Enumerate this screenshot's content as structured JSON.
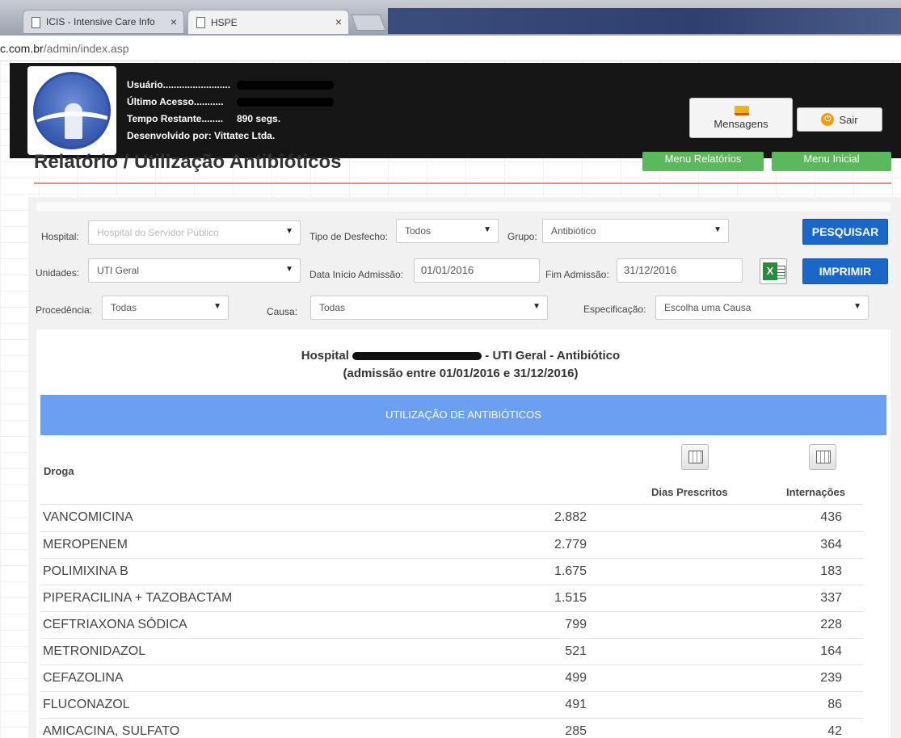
{
  "browser": {
    "tabs": [
      {
        "title": "ICIS - Intensive Care Info"
      },
      {
        "title": "HSPE"
      }
    ],
    "url_domain": "c.com.br",
    "url_path": "/admin/index.asp"
  },
  "header": {
    "user_label": "Usuário.........................",
    "last_access_label": "Último Acesso...........",
    "time_left_label": "Tempo Restante........",
    "time_left_value": "890 segs.",
    "dev_label": "Desenvolvido por:",
    "dev_value": "Vittatec Ltda.",
    "messages_label": "Mensagens",
    "logout_label": "Sair"
  },
  "page": {
    "title": "Relatório / Utilização Antibióticos",
    "reports_menu": "Menu Relatórios",
    "home_menu": "Menu Inicial"
  },
  "filters": {
    "hospital_label": "Hospital:",
    "hospital_value": "Hospital do Servidor Público",
    "outcome_label": "Tipo de Desfecho:",
    "outcome_value": "Todos",
    "group_label": "Grupo:",
    "group_value": "Antibiótico",
    "search_button": "PESQUISAR",
    "units_label": "Unidades:",
    "units_value": "UTI Geral",
    "start_label": "Data Início Admissão:",
    "start_value": "01/01/2016",
    "end_label": "Fim Admissão:",
    "end_value": "31/12/2016",
    "print_button": "IMPRIMIR",
    "origin_label": "Procedência:",
    "origin_value": "Todas",
    "cause_label": "Causa:",
    "cause_value": "Todas",
    "spec_label": "Especificação:",
    "spec_value": "Escolha uma Causa"
  },
  "report": {
    "title_prefix": "Hospital",
    "title_suffix": "- UTI Geral - Antibiótico",
    "subtitle": "(admissão entre 01/01/2016 e 31/12/2016)",
    "section": "UTILIZAÇÃO DE ANTIBIÓTICOS",
    "col_drug": "Droga",
    "col_days": "Dias Prescritos",
    "col_admissions": "Internações",
    "rows": [
      {
        "drug": "VANCOMICINA",
        "days": "2.882",
        "admissions": "436"
      },
      {
        "drug": "MEROPENEM",
        "days": "2.779",
        "admissions": "364"
      },
      {
        "drug": "POLIMIXINA B",
        "days": "1.675",
        "admissions": "183"
      },
      {
        "drug": "PIPERACILINA + TAZOBACTAM",
        "days": "1.515",
        "admissions": "337"
      },
      {
        "drug": "CEFTRIAXONA SÓDICA",
        "days": "799",
        "admissions": "228"
      },
      {
        "drug": "METRONIDAZOL",
        "days": "521",
        "admissions": "164"
      },
      {
        "drug": "CEFAZOLINA",
        "days": "499",
        "admissions": "239"
      },
      {
        "drug": "FLUCONAZOL",
        "days": "491",
        "admissions": "86"
      },
      {
        "drug": "AMICACINA, SULFATO",
        "days": "285",
        "admissions": "42"
      }
    ]
  }
}
